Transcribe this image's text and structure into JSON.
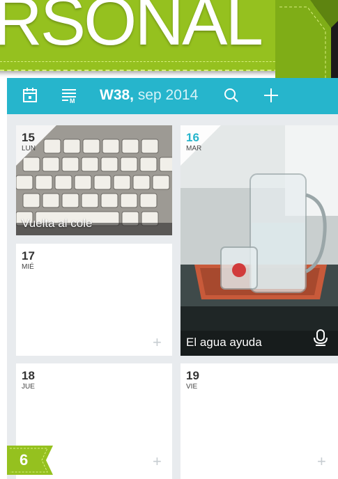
{
  "banner": {
    "title": "RSONAL",
    "color": "#95c11f"
  },
  "toolbar": {
    "bg": "#26b5cc",
    "week": "W38,",
    "month": "sep 2014",
    "icons": [
      "calendar-icon",
      "month-view-icon",
      "search-icon",
      "add-icon"
    ]
  },
  "days": [
    {
      "num": "15",
      "name": "LUN",
      "caption": "Vuelta al cole"
    },
    {
      "num": "16",
      "name": "MAR",
      "caption": "El agua ayuda"
    },
    {
      "num": "17",
      "name": "MIÉ"
    },
    {
      "num": "18",
      "name": "JUE"
    },
    {
      "num": "19",
      "name": "VIE"
    }
  ],
  "page": {
    "number": "6"
  }
}
